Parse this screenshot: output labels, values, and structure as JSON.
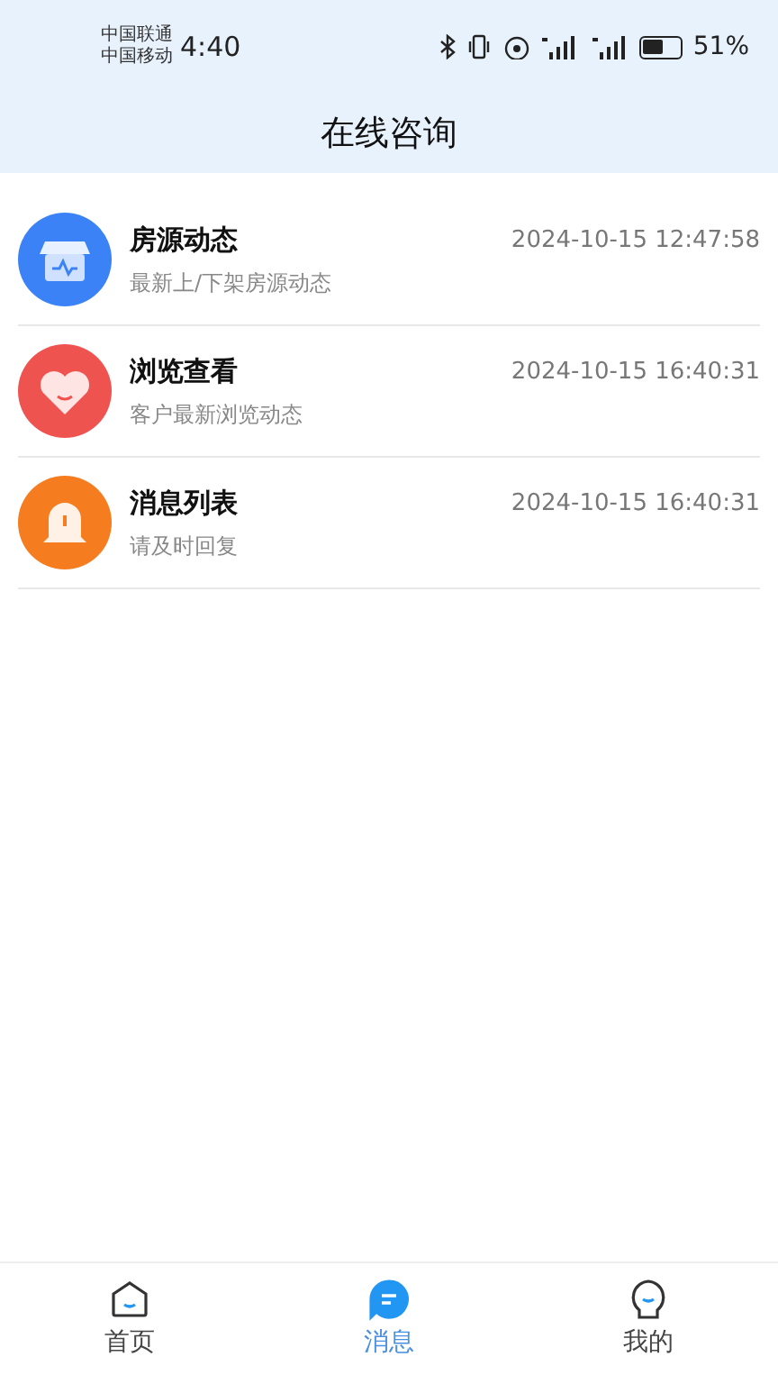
{
  "status_bar": {
    "carriers": [
      "中国联通",
      "中国移动"
    ],
    "time": "4:40",
    "battery": "51%"
  },
  "header": {
    "title": "在线咨询"
  },
  "messages": [
    {
      "kind": "store",
      "title": "房源动态",
      "subtitle": "最新上/下架房源动态",
      "time": "2024-10-15 12:47:58"
    },
    {
      "kind": "heart",
      "title": "浏览查看",
      "subtitle": "客户最新浏览动态",
      "time": "2024-10-15 16:40:31"
    },
    {
      "kind": "bell",
      "title": "消息列表",
      "subtitle": "请及时回复",
      "time": "2024-10-15 16:40:31"
    }
  ],
  "tabs": [
    {
      "kind": "home",
      "label": "首页",
      "selected": false
    },
    {
      "kind": "chat",
      "label": "消息",
      "selected": true
    },
    {
      "kind": "me",
      "label": "我的",
      "selected": false
    }
  ]
}
